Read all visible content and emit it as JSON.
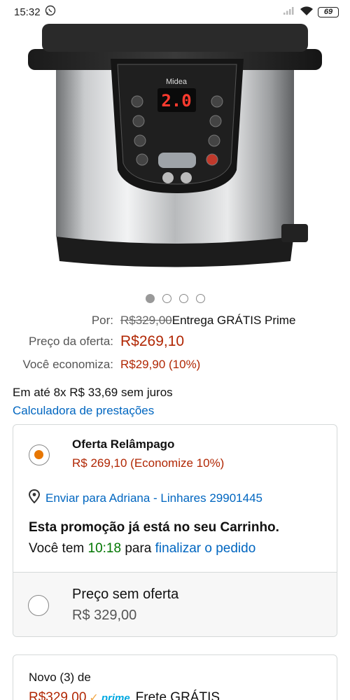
{
  "status_bar": {
    "time": "15:32",
    "battery": "69"
  },
  "product": {
    "brand": "Midea",
    "display_value": "2.0"
  },
  "carousel": {
    "total": 4,
    "active": 1
  },
  "pricing": {
    "por_label": "Por:",
    "original_price": "R$329,00",
    "delivery": "Entrega GRÁTIS Prime",
    "offer_label": "Preço da oferta:",
    "offer_price": "R$269,10",
    "savings_label": "Você economiza:",
    "savings_value": "R$29,90 (10%)"
  },
  "installments": {
    "text": "Em até 8x R$ 33,69 sem juros",
    "calculator_link": "Calculadora de prestações"
  },
  "offer_box": {
    "title": "Oferta Relâmpago",
    "price": "R$ 269,10 (Economize 10%)",
    "ship_to": "Enviar para Adriana - Linhares 29901445",
    "promo_notice": "Esta promoção já está no seu Carrinho.",
    "timer_prefix": "Você tem",
    "timer_value": "10:18",
    "timer_middle": "para",
    "timer_link": "finalizar o pedido",
    "no_offer_label": "Preço sem oferta",
    "no_offer_price": "R$ 329,00"
  },
  "new_offers": {
    "label": "Novo (3) de",
    "price": "R$329,00",
    "prime_label": "prime",
    "shipping": "Frete GRÁTIS"
  },
  "colors": {
    "price_red": "#B12704",
    "link_blue": "#0066c0",
    "timer_green": "#007600",
    "radio_orange": "#e77600"
  }
}
